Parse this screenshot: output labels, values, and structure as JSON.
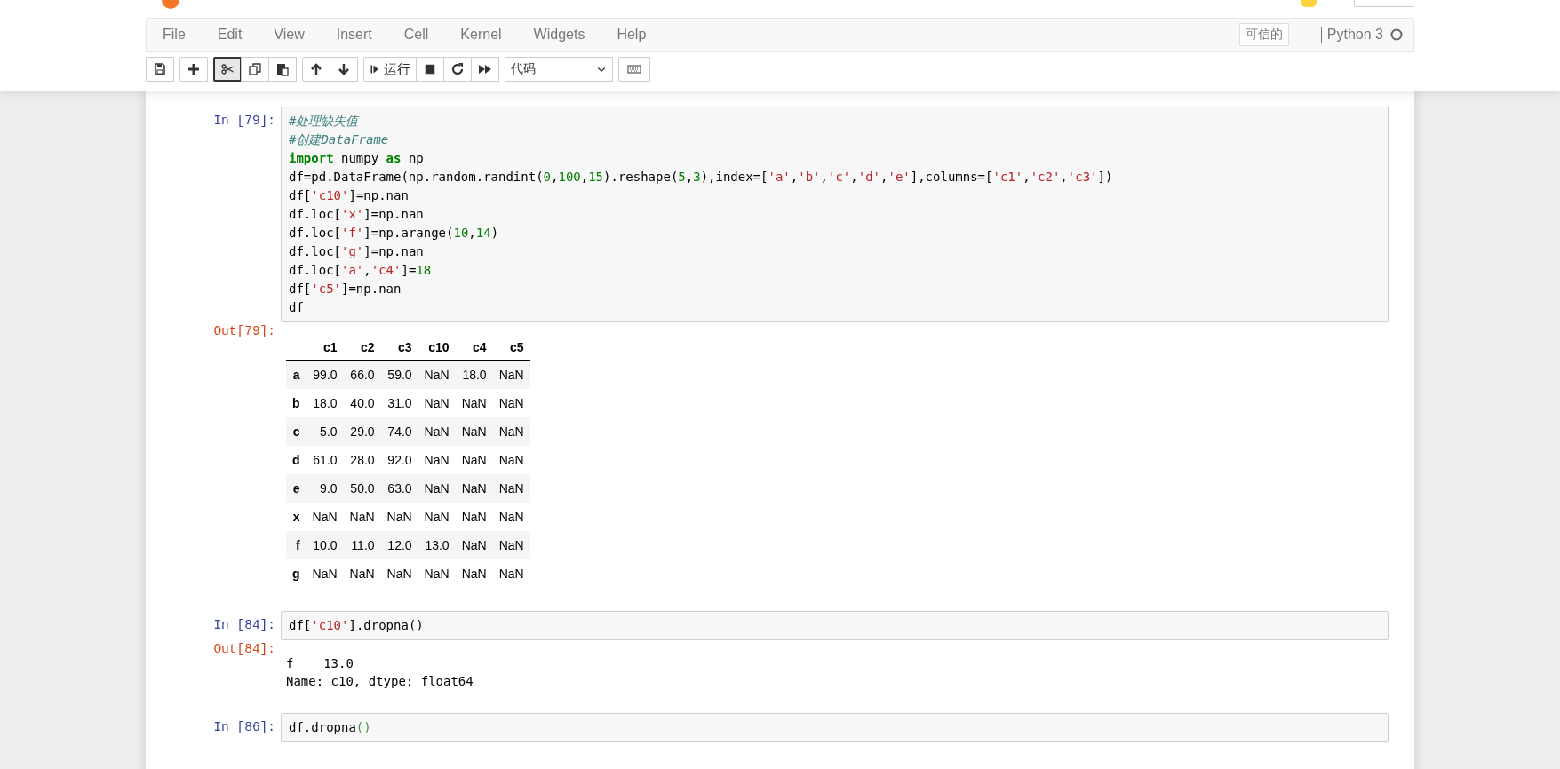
{
  "menu": [
    "File",
    "Edit",
    "View",
    "Insert",
    "Cell",
    "Kernel",
    "Widgets",
    "Help"
  ],
  "trusted": "可信的",
  "kernel": {
    "name": "Python 3",
    "busy": false
  },
  "toolbar": {
    "run_label": "运行",
    "cell_type": "代码"
  },
  "cells": [
    {
      "prompt": "In [79]:",
      "code": [
        [
          {
            "kind": "comment",
            "text": "#处理缺失值"
          }
        ],
        [
          {
            "kind": "comment",
            "text": "#创建DataFrame"
          }
        ],
        [
          {
            "kind": "keyword",
            "text": "import"
          },
          {
            "kind": "plain",
            "text": " numpy "
          },
          {
            "kind": "keyword",
            "text": "as"
          },
          {
            "kind": "plain",
            "text": " np"
          }
        ],
        [
          {
            "kind": "plain",
            "text": "df=pd.DataFrame(np.random.randint("
          },
          {
            "kind": "number",
            "text": "0"
          },
          {
            "kind": "plain",
            "text": ","
          },
          {
            "kind": "number",
            "text": "100"
          },
          {
            "kind": "plain",
            "text": ","
          },
          {
            "kind": "number",
            "text": "15"
          },
          {
            "kind": "plain",
            "text": ").reshape("
          },
          {
            "kind": "number",
            "text": "5"
          },
          {
            "kind": "plain",
            "text": ","
          },
          {
            "kind": "number",
            "text": "3"
          },
          {
            "kind": "plain",
            "text": "),index=["
          },
          {
            "kind": "string",
            "text": "'a'"
          },
          {
            "kind": "plain",
            "text": ","
          },
          {
            "kind": "string",
            "text": "'b'"
          },
          {
            "kind": "plain",
            "text": ","
          },
          {
            "kind": "string",
            "text": "'c'"
          },
          {
            "kind": "plain",
            "text": ","
          },
          {
            "kind": "string",
            "text": "'d'"
          },
          {
            "kind": "plain",
            "text": ","
          },
          {
            "kind": "string",
            "text": "'e'"
          },
          {
            "kind": "plain",
            "text": "],columns=["
          },
          {
            "kind": "string",
            "text": "'c1'"
          },
          {
            "kind": "plain",
            "text": ","
          },
          {
            "kind": "string",
            "text": "'c2'"
          },
          {
            "kind": "plain",
            "text": ","
          },
          {
            "kind": "string",
            "text": "'c3'"
          },
          {
            "kind": "plain",
            "text": "])"
          }
        ],
        [
          {
            "kind": "plain",
            "text": "df["
          },
          {
            "kind": "string",
            "text": "'c10'"
          },
          {
            "kind": "plain",
            "text": "]=np.nan"
          }
        ],
        [
          {
            "kind": "plain",
            "text": "df.loc["
          },
          {
            "kind": "string",
            "text": "'x'"
          },
          {
            "kind": "plain",
            "text": "]=np.nan"
          }
        ],
        [
          {
            "kind": "plain",
            "text": "df.loc["
          },
          {
            "kind": "string",
            "text": "'f'"
          },
          {
            "kind": "plain",
            "text": "]=np.arange("
          },
          {
            "kind": "number",
            "text": "10"
          },
          {
            "kind": "plain",
            "text": ","
          },
          {
            "kind": "number",
            "text": "14"
          },
          {
            "kind": "plain",
            "text": ")"
          }
        ],
        [
          {
            "kind": "plain",
            "text": "df.loc["
          },
          {
            "kind": "string",
            "text": "'g'"
          },
          {
            "kind": "plain",
            "text": "]=np.nan"
          }
        ],
        [
          {
            "kind": "plain",
            "text": "df.loc["
          },
          {
            "kind": "string",
            "text": "'a'"
          },
          {
            "kind": "plain",
            "text": ","
          },
          {
            "kind": "string",
            "text": "'c4'"
          },
          {
            "kind": "plain",
            "text": "]="
          },
          {
            "kind": "number",
            "text": "18"
          }
        ],
        [
          {
            "kind": "plain",
            "text": "df["
          },
          {
            "kind": "string",
            "text": "'c5'"
          },
          {
            "kind": "plain",
            "text": "]=np.nan"
          }
        ],
        [
          {
            "kind": "plain",
            "text": "df"
          }
        ]
      ],
      "output": {
        "kind": "table",
        "prompt": "Out[79]:",
        "columns": [
          "c1",
          "c2",
          "c3",
          "c10",
          "c4",
          "c5"
        ],
        "rows": [
          {
            "index": "a",
            "values": [
              "99.0",
              "66.0",
              "59.0",
              "NaN",
              "18.0",
              "NaN"
            ]
          },
          {
            "index": "b",
            "values": [
              "18.0",
              "40.0",
              "31.0",
              "NaN",
              "NaN",
              "NaN"
            ]
          },
          {
            "index": "c",
            "values": [
              "5.0",
              "29.0",
              "74.0",
              "NaN",
              "NaN",
              "NaN"
            ]
          },
          {
            "index": "d",
            "values": [
              "61.0",
              "28.0",
              "92.0",
              "NaN",
              "NaN",
              "NaN"
            ]
          },
          {
            "index": "e",
            "values": [
              "9.0",
              "50.0",
              "63.0",
              "NaN",
              "NaN",
              "NaN"
            ]
          },
          {
            "index": "x",
            "values": [
              "NaN",
              "NaN",
              "NaN",
              "NaN",
              "NaN",
              "NaN"
            ]
          },
          {
            "index": "f",
            "values": [
              "10.0",
              "11.0",
              "12.0",
              "13.0",
              "NaN",
              "NaN"
            ]
          },
          {
            "index": "g",
            "values": [
              "NaN",
              "NaN",
              "NaN",
              "NaN",
              "NaN",
              "NaN"
            ]
          }
        ]
      }
    },
    {
      "prompt": "In [84]:",
      "code": [
        [
          {
            "kind": "plain",
            "text": "df["
          },
          {
            "kind": "string",
            "text": "'c10'"
          },
          {
            "kind": "plain",
            "text": "].dropna()"
          }
        ]
      ],
      "output": {
        "kind": "text",
        "prompt": "Out[84]:",
        "lines": [
          "f    13.0",
          "Name: c10, dtype: float64"
        ]
      }
    },
    {
      "prompt": "In [86]:",
      "code": [
        [
          {
            "kind": "plain",
            "text": "df.dropna"
          },
          {
            "kind": "paren",
            "text": "()"
          }
        ]
      ]
    }
  ]
}
